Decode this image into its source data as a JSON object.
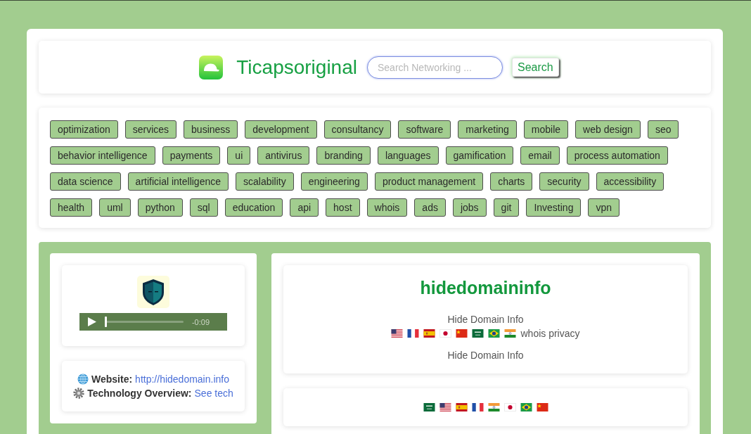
{
  "header": {
    "title": "Ticapsoriginal",
    "search": {
      "placeholder": "Search Networking ..."
    },
    "search_button": "Search"
  },
  "tag_rows": [
    [
      "optimization",
      "services",
      "business",
      "development",
      "consultancy",
      "software",
      "marketing",
      "mobile",
      "web design",
      "seo"
    ],
    [
      "behavior intelligence",
      "payments",
      "ui",
      "antivirus",
      "branding",
      "languages",
      "gamification",
      "email",
      "process automation"
    ],
    [
      "data science",
      "artificial intelligence",
      "scalability",
      "engineering",
      "product management",
      "charts",
      "security",
      "accessibility"
    ],
    [
      "health",
      "uml",
      "python",
      "sql",
      "education",
      "api",
      "host",
      "whois",
      "ads",
      "jobs",
      "git",
      "Investing",
      "vpn"
    ]
  ],
  "media": {
    "audio": {
      "time": "-0:09",
      "level": 0
    }
  },
  "links": [
    {
      "kind": "globe",
      "label": "Website:",
      "link": "http://hidedomain.info"
    },
    {
      "kind": "gear",
      "label": "Technology Overview:",
      "link": "See tech"
    }
  ],
  "detail": {
    "title": "hidedomaininfo",
    "subtitle": "Hide Domain Info",
    "flags": [
      {
        "kind": "us"
      },
      {
        "kind": "france"
      },
      {
        "kind": "spain"
      },
      {
        "kind": "japan"
      },
      {
        "kind": "china"
      },
      {
        "kind": "saudi"
      },
      {
        "kind": "brazil"
      },
      {
        "kind": "india"
      }
    ],
    "tagline": "whois privacy",
    "description": "Hide Domain Info"
  },
  "flag_strip": [
    {
      "kind": "saudi"
    },
    {
      "kind": "us"
    },
    {
      "kind": "spain"
    },
    {
      "kind": "france"
    },
    {
      "kind": "india"
    },
    {
      "kind": "japan"
    },
    {
      "kind": "brazil"
    },
    {
      "kind": "china"
    }
  ]
}
